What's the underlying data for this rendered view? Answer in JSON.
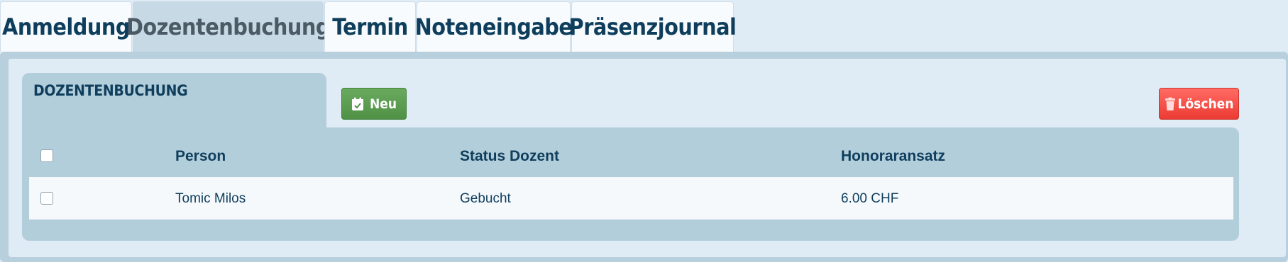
{
  "tabs": [
    {
      "label": "Anmeldung",
      "active": false
    },
    {
      "label": "Dozentenbuchung",
      "active": true
    },
    {
      "label": "Termin",
      "active": false
    },
    {
      "label": "Noteneingabe",
      "active": false
    },
    {
      "label": "Präsenzjournal",
      "active": false
    }
  ],
  "section": {
    "title": "DOZENTENBUCHUNG"
  },
  "toolbar": {
    "new_label": "Neu",
    "new_icon": "calendar-check-icon",
    "delete_label": "Löschen",
    "delete_icon": "trash-icon"
  },
  "table": {
    "columns": [
      "Person",
      "Status Dozent",
      "Honoraransatz"
    ],
    "rows": [
      {
        "person": "Tomic Milos",
        "status": "Gebucht",
        "honorar": "6.00 CHF",
        "checked": false
      }
    ]
  },
  "colors": {
    "primary_text": "#0f3e5c",
    "new_button": "#5c9e50",
    "delete_button": "#f54a42",
    "panel": "#b3cedb"
  }
}
